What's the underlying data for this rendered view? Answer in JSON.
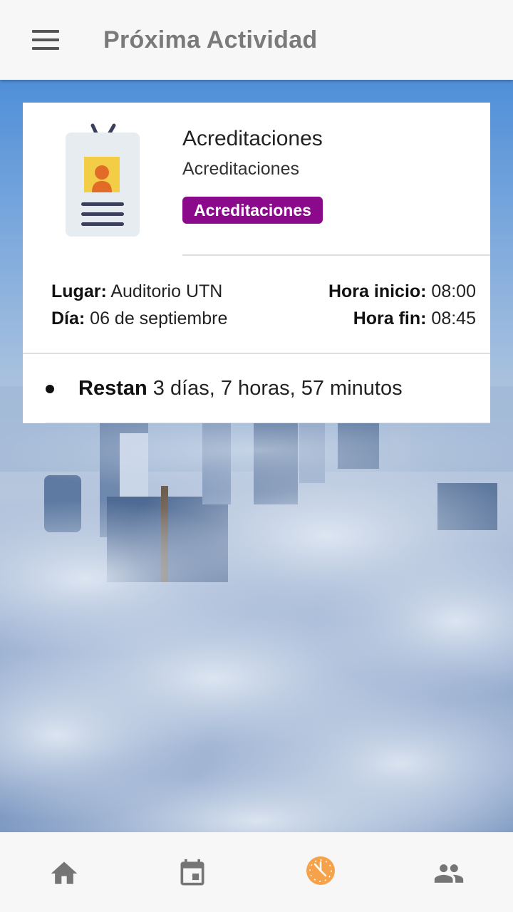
{
  "appbar": {
    "title": "Próxima Actividad",
    "menu_icon": "menu-icon"
  },
  "activity": {
    "title": "Acreditaciones",
    "subtitle": "Acreditaciones",
    "tag": "Acreditaciones",
    "tag_color": "#8b0a8b",
    "icon": "id-badge-icon",
    "lugar_label": "Lugar:",
    "lugar_value": " Auditorio UTN",
    "dia_label": "Día:",
    "dia_value": " 06 de septiembre",
    "inicio_label": "Hora inicio:",
    "inicio_value": " 08:00",
    "fin_label": "Hora fin:",
    "fin_value": " 08:45"
  },
  "countdown": {
    "label": "Restan",
    "value": " 3 días, 7 horas, 57 minutos"
  },
  "bottom_nav": {
    "items": [
      {
        "icon": "home-icon",
        "active": false
      },
      {
        "icon": "calendar-icon",
        "active": false
      },
      {
        "icon": "clock-icon",
        "active": true
      },
      {
        "icon": "people-icon",
        "active": false
      }
    ],
    "active_color": "#f5a24b",
    "inactive_color": "#757575"
  }
}
